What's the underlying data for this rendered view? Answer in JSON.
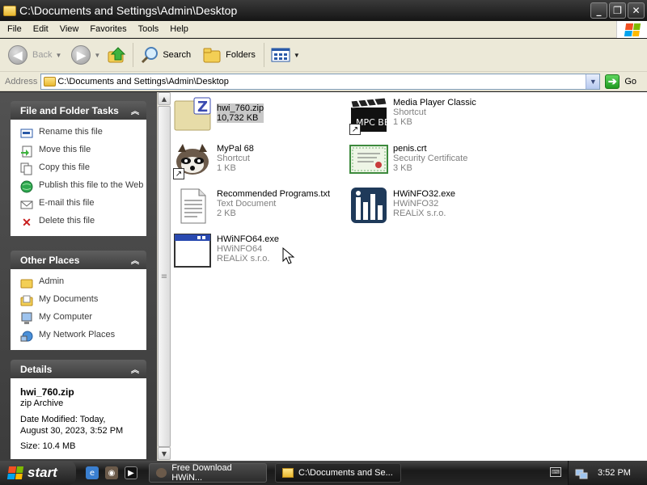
{
  "window": {
    "title": "C:\\Documents and Settings\\Admin\\Desktop",
    "buttons": {
      "minimize": "_",
      "maximize": "❐",
      "close": "✕"
    }
  },
  "menubar": {
    "items": [
      "File",
      "Edit",
      "View",
      "Favorites",
      "Tools",
      "Help"
    ]
  },
  "toolbar": {
    "back_label": "Back",
    "search_label": "Search",
    "folders_label": "Folders"
  },
  "addressbar": {
    "label": "Address",
    "value": "C:\\Documents and Settings\\Admin\\Desktop",
    "go_label": "Go"
  },
  "tasks_panel": {
    "title": "File and Folder Tasks",
    "items": [
      {
        "label": "Rename this file",
        "icon": "rename-icon"
      },
      {
        "label": "Move this file",
        "icon": "move-icon"
      },
      {
        "label": "Copy this file",
        "icon": "copy-icon"
      },
      {
        "label": "Publish this file to the Web",
        "icon": "publish-icon"
      },
      {
        "label": "E-mail this file",
        "icon": "email-icon"
      },
      {
        "label": "Delete this file",
        "icon": "delete-icon"
      }
    ]
  },
  "places_panel": {
    "title": "Other Places",
    "items": [
      {
        "label": "Admin",
        "icon": "folder-icon"
      },
      {
        "label": "My Documents",
        "icon": "my-documents-icon"
      },
      {
        "label": "My Computer",
        "icon": "my-computer-icon"
      },
      {
        "label": "My Network Places",
        "icon": "network-icon"
      }
    ]
  },
  "details_panel": {
    "title": "Details",
    "name": "hwi_760.zip",
    "type": "zip Archive",
    "modified_1": "Date Modified: Today,",
    "modified_2": "August 30, 2023, 3:52 PM",
    "size": "Size: 10.4 MB"
  },
  "files": [
    {
      "name": "hwi_760.zip",
      "line2": "10,732 KB",
      "line3": "",
      "icon": "zip-archive-icon",
      "selected": true
    },
    {
      "name": "Media Player Classic",
      "line2": "Shortcut",
      "line3": "1 KB",
      "icon": "mpc-shortcut-icon",
      "selected": false
    },
    {
      "name": "MyPal 68",
      "line2": "Shortcut",
      "line3": "1 KB",
      "icon": "mypal-shortcut-icon",
      "selected": false
    },
    {
      "name": "penis.crt",
      "line2": "Security Certificate",
      "line3": "3 KB",
      "icon": "certificate-icon",
      "selected": false
    },
    {
      "name": "Recommended Programs.txt",
      "line2": "Text Document",
      "line3": "2 KB",
      "icon": "text-document-icon",
      "selected": false
    },
    {
      "name": "HWiNFO32.exe",
      "line2": "HWiNFO32",
      "line3": "REALiX s.r.o.",
      "icon": "hwinfo-icon",
      "selected": false
    },
    {
      "name": "HWiNFO64.exe",
      "line2": "HWiNFO64",
      "line3": "REALiX s.r.o.",
      "icon": "exe-window-icon",
      "selected": false
    }
  ],
  "taskbar": {
    "start_label": "start",
    "buttons": [
      {
        "label": "Free Download HWiN...",
        "icon": "browser-icon",
        "active": false
      },
      {
        "label": "C:\\Documents and Se...",
        "icon": "folder-icon",
        "active": true
      }
    ],
    "clock": "3:52 PM"
  },
  "colors": {
    "selection": "#c8c8c8",
    "panel_header": "#4a4a4a",
    "chrome": "#ece9d8"
  }
}
